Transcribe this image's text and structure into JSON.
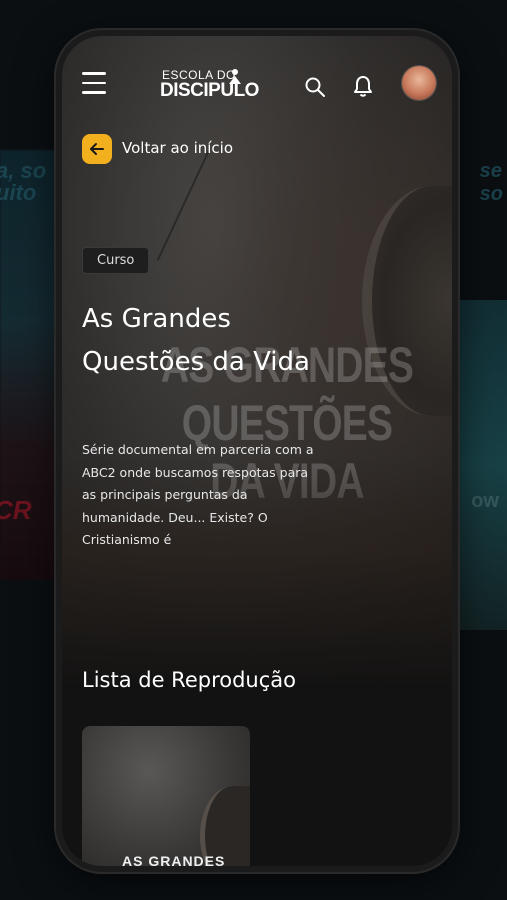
{
  "background": {
    "left_text": "a, so\nuito",
    "left_red_text": "CR",
    "right_text": "se\nso",
    "right_low_text": "ow"
  },
  "header": {
    "logo_top": "ESCOLA DO",
    "logo_bottom": "DISCIPULO",
    "icons": [
      "menu-icon",
      "search-icon",
      "bell-icon"
    ]
  },
  "back": {
    "label": "Voltar ao início"
  },
  "course": {
    "badge": "Curso",
    "title": "As Grandes Questões da Vida",
    "watermark": "AS GRANDES\nQUESTÕES DA VIDA",
    "description": "Série documental em parceria com a ABC2 onde buscamos respotas para as principais perguntas da humanidade. Deu... Existe? O Cristianismo é"
  },
  "playlist": {
    "title": "Lista de Reprodução",
    "items": [
      {
        "thumb_text": "AS GRANDES"
      }
    ]
  },
  "colors": {
    "accent": "#f2b01e",
    "background": "#121212"
  }
}
